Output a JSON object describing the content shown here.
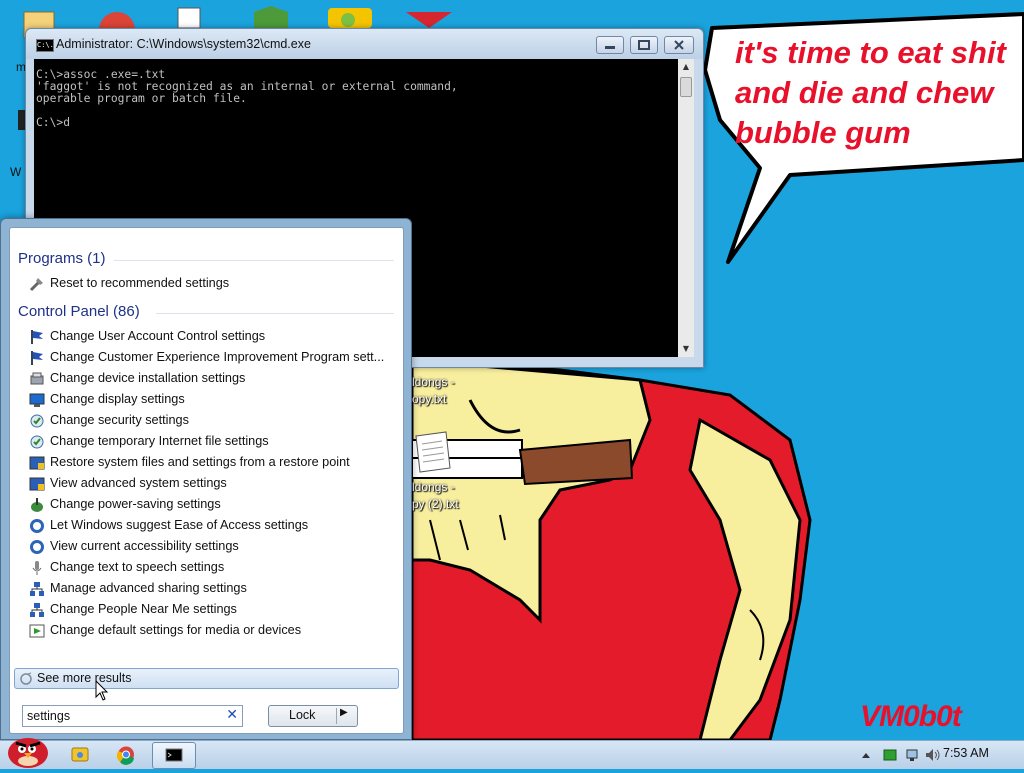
{
  "bubble": {
    "text": "it's time to eat shit\nand die and chew\nbubble gum"
  },
  "watermark": "VM0b0t",
  "desktop": {
    "left_labels": [
      "m",
      "W"
    ],
    "file1": {
      "line1": "ldongs -",
      "line2": "opy.txt"
    },
    "file2": {
      "line1": "ldongs -",
      "line2": "py (2).txt"
    }
  },
  "cmd": {
    "title": "Administrator: C:\\Windows\\system32\\cmd.exe",
    "icon_text": "C:\\.",
    "output": "C:\\>assoc .exe=.txt\n'faggot' is not recognized as an internal or external command,\noperable program or batch file.\n\nC:\\>d"
  },
  "start_menu": {
    "programs": {
      "title": "Programs (1)",
      "items": [
        {
          "label": "Reset to recommended settings",
          "icon": "tools-icon"
        }
      ]
    },
    "control_panel": {
      "title": "Control Panel (86)",
      "items": [
        {
          "label": "Change User Account Control settings",
          "icon": "flag-icon"
        },
        {
          "label": "Change Customer Experience Improvement Program sett...",
          "icon": "flag-icon"
        },
        {
          "label": "Change device installation settings",
          "icon": "device-icon"
        },
        {
          "label": "Change display settings",
          "icon": "monitor-icon"
        },
        {
          "label": "Change security settings",
          "icon": "security-icon"
        },
        {
          "label": "Change temporary Internet file settings",
          "icon": "internet-options-icon"
        },
        {
          "label": "Restore system files and settings from a restore point",
          "icon": "system-icon"
        },
        {
          "label": "View advanced system settings",
          "icon": "system-icon"
        },
        {
          "label": "Change power-saving settings",
          "icon": "power-icon"
        },
        {
          "label": "Let Windows suggest Ease of Access settings",
          "icon": "ease-of-access-icon"
        },
        {
          "label": "View current accessibility settings",
          "icon": "ease-of-access-icon"
        },
        {
          "label": "Change text to speech settings",
          "icon": "microphone-icon"
        },
        {
          "label": "Manage advanced sharing settings",
          "icon": "network-icon"
        },
        {
          "label": "Change People Near Me settings",
          "icon": "network-icon"
        },
        {
          "label": "Change default settings for media or devices",
          "icon": "autoplay-icon"
        }
      ]
    },
    "see_more": "See more results",
    "search": {
      "value": "settings",
      "placeholder": ""
    },
    "lock_label": "Lock"
  },
  "taskbar": {
    "clock": "7:53 AM",
    "buttons": [
      "angry-birds-start-icon",
      "explorer-icon",
      "chrome-icon",
      "cmd-icon"
    ]
  },
  "colors": {
    "desktop_bg": "#1aa3dd",
    "bubble_text": "#e8102a",
    "shirt": "#e41b2a",
    "skin": "#f7ee9e"
  }
}
